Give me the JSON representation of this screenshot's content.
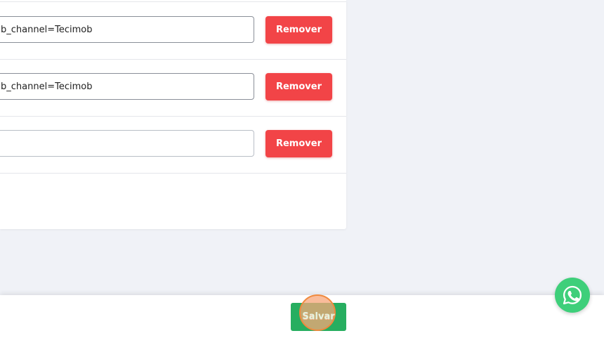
{
  "links": {
    "rows": [
      {
        "url_value": "b_channel=Tecimob",
        "remove_label": "Remover"
      },
      {
        "url_value": "b_channel=Tecimob",
        "remove_label": "Remover"
      },
      {
        "url_value": "",
        "remove_label": "Remover"
      }
    ]
  },
  "footer": {
    "save_label": "Salvar"
  },
  "colors": {
    "remove_button": "#f24447",
    "save_button": "#27ae60",
    "whatsapp": "#3ecf7a",
    "page_background": "#f0f2f7"
  },
  "icons": {
    "floating_chat": "whatsapp-icon"
  }
}
